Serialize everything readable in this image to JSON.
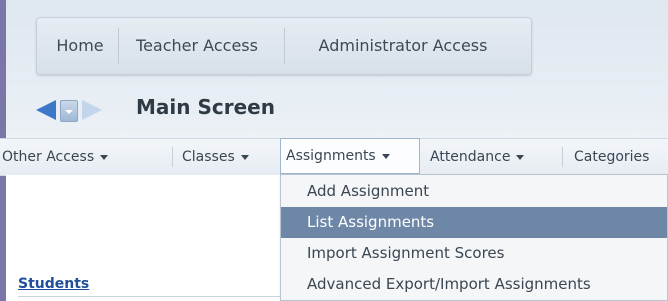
{
  "top_nav": {
    "tabs": [
      "Home",
      "Teacher Access",
      "Administrator Access"
    ]
  },
  "toolbar": {
    "title": "Main Screen",
    "back_icon": "arrow-left-icon",
    "menu_icon": "dropdown-menu-icon",
    "forward_icon": "arrow-right-icon"
  },
  "menubar": {
    "items": [
      "Other Access",
      "Classes",
      "Assignments",
      "Attendance",
      "Categories"
    ],
    "active": "Assignments"
  },
  "dropdown": {
    "items": [
      "Add Assignment",
      "List Assignments",
      "Import Assignment Scores",
      "Advanced Export/Import Assignments"
    ],
    "highlighted": "List Assignments"
  },
  "sidebar": {
    "students_link": "Students"
  },
  "colors": {
    "highlight": "#6e87a6",
    "link": "#1f4f9a",
    "nav_arrow": "#3b79c8"
  }
}
